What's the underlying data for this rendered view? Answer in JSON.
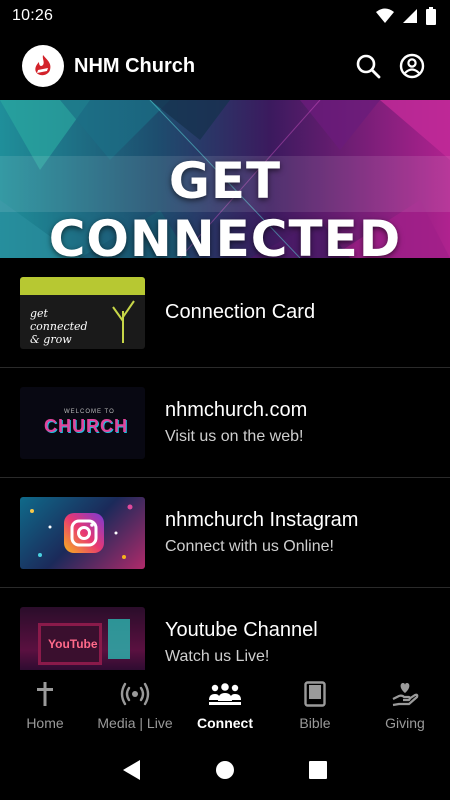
{
  "status": {
    "time": "10:26"
  },
  "header": {
    "title": "NHM Church",
    "search_icon": "search-icon",
    "account_icon": "account-circle-icon"
  },
  "banner": {
    "title": "GET CONNECTED"
  },
  "list": [
    {
      "title": "Connection Card",
      "subtitle": "",
      "thumb_text": "get connected & grow"
    },
    {
      "title": "nhmchurch.com",
      "subtitle": "Visit us on the web!",
      "thumb_text": "CHURCH",
      "thumb_small": "WELCOME TO"
    },
    {
      "title": "nhmchurch Instagram",
      "subtitle": "Connect with us Online!"
    },
    {
      "title": "Youtube Channel",
      "subtitle": "Watch us Live!",
      "thumb_text": "YouTube"
    }
  ],
  "nav": [
    {
      "label": "Home",
      "icon": "cross-icon"
    },
    {
      "label": "Media | Live",
      "icon": "broadcast-icon"
    },
    {
      "label": "Connect",
      "icon": "group-icon",
      "active": true
    },
    {
      "label": "Bible",
      "icon": "book-icon"
    },
    {
      "label": "Giving",
      "icon": "hand-heart-icon"
    }
  ],
  "colors": {
    "background": "#000000",
    "active": "#ffffff",
    "inactive": "#9a9a9a",
    "logo_red": "#d3222a"
  }
}
